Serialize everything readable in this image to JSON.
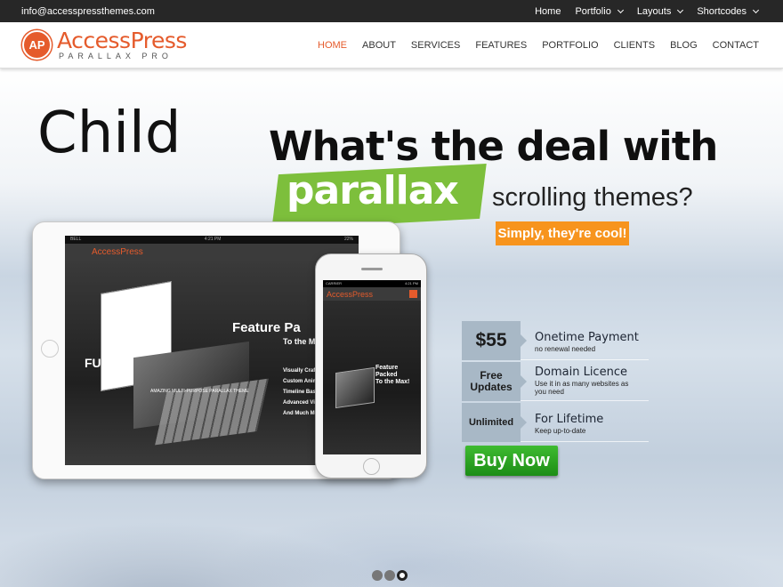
{
  "topbar": {
    "email": "info@accesspressthemes.com",
    "nav": [
      "Home",
      "Portfolio",
      "Layouts",
      "Shortcodes"
    ]
  },
  "header": {
    "logo_mark": "AP",
    "logo_name": "AccessPress",
    "logo_sub": "PARALLAX PRO",
    "nav": [
      "HOME",
      "ABOUT",
      "SERVICES",
      "FEATURES",
      "PORTFOLIO",
      "CLIENTS",
      "BLOG",
      "CONTACT"
    ],
    "active": "HOME",
    "accent": "#e55b2c"
  },
  "hero": {
    "child": "Child",
    "headline": "What's the deal with",
    "highlight": "parallax",
    "tail": "scrolling themes?",
    "tagline": "Simply, they're cool!",
    "highlight_color": "#7dbf3c",
    "tagline_color": "#f7941d"
  },
  "tablet": {
    "status_left": "BELL",
    "status_time": "4:21 PM",
    "status_right": "22%",
    "logo": "AccessPress",
    "feature_title": "Feature Pa",
    "feature_sub": "To the M",
    "list": [
      "Visually Craft",
      "Custom Animati",
      "Timeline Base",
      "Advanced Vide",
      "And Much Mor"
    ],
    "amazing": "AMAZING MULTI-PURPOSE PARALLAX THEME",
    "full": "FUL"
  },
  "phone": {
    "status_left": "CARRIER",
    "status_time": "4:21 PM",
    "logo": "AccessPress",
    "feature_title": "Feature Packed",
    "feature_sub": "To the Max!"
  },
  "pricing": [
    {
      "box": "$55",
      "title": "Onetime Payment",
      "sub": "no renewal needed"
    },
    {
      "box": "Free Updates",
      "title": "Domain Licence",
      "sub": "Use it in as many websites as you need"
    },
    {
      "box": "Unlimited",
      "title": "For Lifetime",
      "sub": "Keep up-to-date"
    }
  ],
  "buy_label": "Buy Now",
  "buy_color": "#2aa020",
  "slider": {
    "count": 3,
    "active": 3
  }
}
